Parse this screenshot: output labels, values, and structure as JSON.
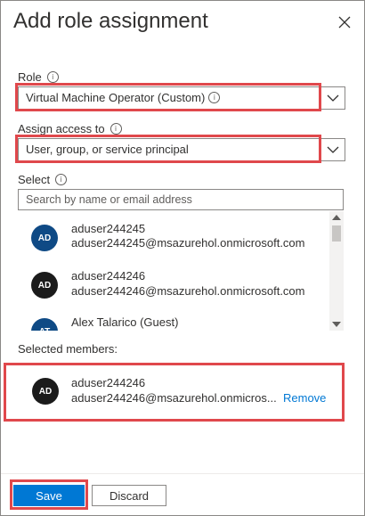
{
  "panel": {
    "title": "Add role assignment"
  },
  "role": {
    "label": "Role",
    "value": "Virtual Machine Operator (Custom)"
  },
  "assign_access": {
    "label": "Assign access to",
    "value": "User, group, or service principal"
  },
  "select": {
    "label": "Select",
    "placeholder": "Search by name or email address"
  },
  "members": [
    {
      "initials": "AD",
      "name": "aduser244245",
      "email": "aduser244245@msazurehol.onmicrosoft.com",
      "color": "#0f4a85"
    },
    {
      "initials": "AD",
      "name": "aduser244246",
      "email": "aduser244246@msazurehol.onmicrosoft.com",
      "color": "#1b1b1b"
    },
    {
      "initials": "AT",
      "name": "Alex Talarico (Guest)",
      "email": "",
      "color": "#0f4a85"
    }
  ],
  "selected_members": {
    "label": "Selected members:",
    "items": [
      {
        "initials": "AD",
        "name": "aduser244246",
        "email": "aduser244246@msazurehol.onmicros...",
        "remove_label": "Remove",
        "color": "#1b1b1b"
      }
    ]
  },
  "footer": {
    "save_label": "Save",
    "discard_label": "Discard"
  },
  "colors": {
    "accent": "#0078d4",
    "highlight": "#e0484c"
  }
}
